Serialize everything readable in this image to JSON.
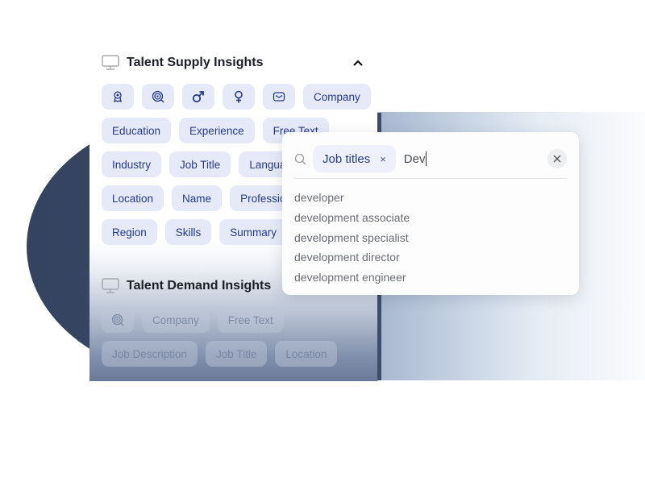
{
  "supply": {
    "title": "Talent Supply Insights",
    "icon": "monitor-icon",
    "collapse_icon": "chevron-up-icon",
    "icon_chips": [
      "badge-icon",
      "target-search-icon",
      "male-icon",
      "female-icon",
      "email-icon"
    ],
    "rows": [
      [
        "Company"
      ],
      [
        "Education",
        "Experience",
        "Free Text"
      ],
      [
        "Industry",
        "Job Title",
        "Language"
      ],
      [
        "Location",
        "Name",
        "Profession"
      ],
      [
        "Region",
        "Skills",
        "Summary"
      ]
    ]
  },
  "demand": {
    "title": "Talent Demand Insights",
    "icon": "monitor-icon",
    "icon_chips": [
      "target-search-icon"
    ],
    "rows": [
      [
        "Company",
        "Free Text"
      ],
      [
        "Job Description",
        "Job Title",
        "Location"
      ]
    ]
  },
  "search": {
    "icon": "search-icon",
    "tag_label": "Job titles",
    "tag_remove": "×",
    "query": "Dev",
    "clear_icon": "close-icon",
    "suggestions": [
      "developer",
      "development associate",
      "development specialist",
      "development director",
      "development engineer"
    ]
  },
  "colors": {
    "chip_bg": "#e6eaf8",
    "chip_text": "#263a8f",
    "dark_shape": "#34435f"
  }
}
